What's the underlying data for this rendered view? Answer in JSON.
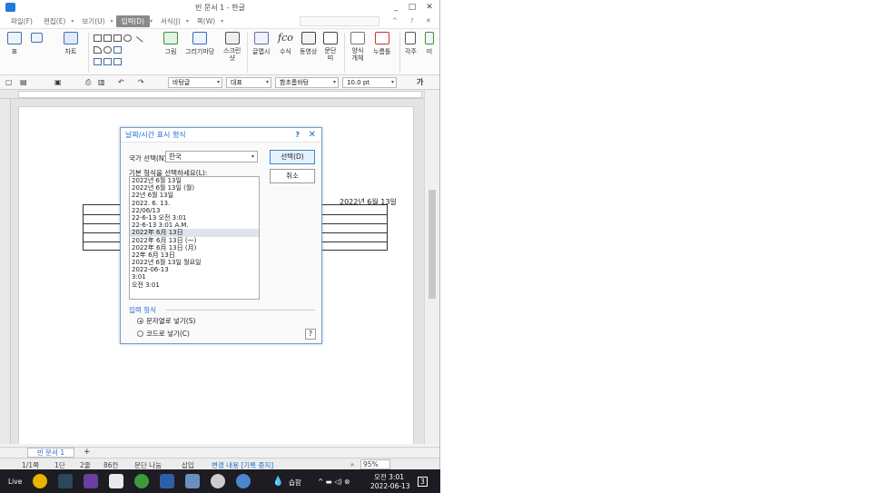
{
  "window": {
    "title": "빈 문서 1 - 한글",
    "min": "_",
    "max": "□",
    "close": "✕"
  },
  "menubar": {
    "items": [
      "파일(F)",
      "편집(E)",
      "보기(U)",
      "입력(D)",
      "서식(J)",
      "쪽(W)"
    ],
    "dropdown": "▾",
    "right_controls": [
      "^",
      "?",
      "✕"
    ]
  },
  "ribbon": {
    "labels": {
      "table": "표",
      "chart": "차트",
      "picture": "그림",
      "drawing": "그리기마당",
      "screenshot": "스크린\n샷",
      "glyph": "글맵시",
      "formula": "수식",
      "video": "동영상",
      "paragraph": "문단\n띠",
      "form": "양식\n개체",
      "memo": "누름틀",
      "footnote": "각주",
      "more": "미"
    }
  },
  "toolbar": {
    "style_combo": "바탕글",
    "para_combo": "대표",
    "font_combo": "함초롬바탕",
    "size_combo": "10.0",
    "size_unit": "pt",
    "bold": "가"
  },
  "document": {
    "date_text": "2022년 6월 13일"
  },
  "dialog": {
    "title": "날짜/시간 표시 형식",
    "help_glyph": "?",
    "close_glyph": "✕",
    "country_label": "국가 선택(N):",
    "country_value": "한국",
    "format_label": "기본 형식을 선택하세요(L):",
    "formats": [
      "2022년 6월 13일",
      "2022년 6월 13일 (월)",
      "22년 6월 13일",
      "2022. 6. 13.",
      "22/06/13",
      "22-6-13 오전 3:01",
      "22-6-13 3:01 A.M.",
      "2022年 6月 13日",
      "2022年 6月 13日 (一)",
      "2022年 6月 13日 (月)",
      "22年 6月 13日",
      "2022년 6월 13일 월요일",
      "2022-06-13",
      "3:01",
      "오전 3:01"
    ],
    "selected_index": 7,
    "ok_button": "선택(D)",
    "cancel_button": "취소",
    "input_section": "입력 형식",
    "radio_text": "문자열로 넣기(S)",
    "radio_code": "코드로 넣기(C)",
    "help_button": "?"
  },
  "tabs": {
    "doc_tab": "빈 문서 1",
    "add": "+"
  },
  "status": {
    "page": "1/1쪽",
    "section": "1단",
    "line": "2줄",
    "column": "86칸",
    "paragraph": "문단 나눔",
    "insert": "삽입",
    "track": "변경 내용 [기록 중지]",
    "zoom": "95%"
  },
  "taskbar": {
    "live": "Live",
    "weather": "습함",
    "time": "오전 3:01",
    "date": "2022-06-13",
    "notif": "3"
  }
}
